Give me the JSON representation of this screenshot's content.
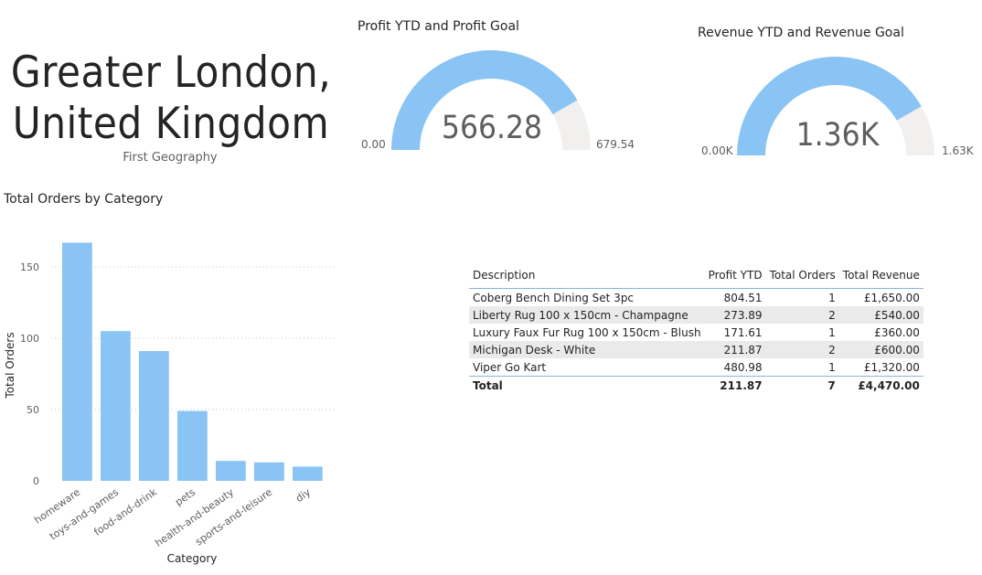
{
  "header": {
    "title_line1": "Greater London,",
    "title_line2": "United Kingdom",
    "subtitle": "First Geography"
  },
  "gauges": [
    {
      "title": "Profit YTD and Profit Goal",
      "value": 566.28,
      "value_label": "566.28",
      "min_label": "0.00",
      "max_label": "679.54",
      "min": 0,
      "max": 679.54,
      "fill_color": "#89c4f4",
      "track_color": "#f1f0ef"
    },
    {
      "title": "Revenue YTD and Revenue Goal",
      "value": 1.36,
      "value_label": "1.36K",
      "min_label": "0.00K",
      "max_label": "1.63K",
      "min": 0,
      "max": 1.63,
      "fill_color": "#89c4f4",
      "track_color": "#f1f0ef"
    }
  ],
  "chart_data": {
    "type": "bar",
    "title": "Total Orders by Category",
    "xlabel": "Category",
    "ylabel": "Total Orders",
    "categories": [
      "homeware",
      "toys-and-games",
      "food-and-drink",
      "pets",
      "health-and-beauty",
      "sports-and-leisure",
      "diy"
    ],
    "values": [
      167,
      105,
      91,
      49,
      14,
      13,
      10
    ],
    "ylim": [
      0,
      175
    ],
    "yticks": [
      0,
      50,
      100,
      150
    ],
    "grid": true,
    "bar_color": "#89c4f4"
  },
  "table": {
    "columns": [
      "Description",
      "Profit YTD",
      "Total Orders",
      "Total Revenue"
    ],
    "rows": [
      [
        "Coberg Bench Dining Set 3pc",
        "804.51",
        "1",
        "£1,650.00"
      ],
      [
        "Liberty Rug 100 x 150cm - Champagne",
        "273.89",
        "2",
        "£540.00"
      ],
      [
        "Luxury Faux Fur Rug 100 x 150cm - Blush",
        "171.61",
        "1",
        "£360.00"
      ],
      [
        "Michigan Desk - White",
        "211.87",
        "2",
        "£600.00"
      ],
      [
        "Viper Go Kart",
        "480.98",
        "1",
        "£1,320.00"
      ]
    ],
    "total": [
      "Total",
      "211.87",
      "7",
      "£4,470.00"
    ]
  }
}
